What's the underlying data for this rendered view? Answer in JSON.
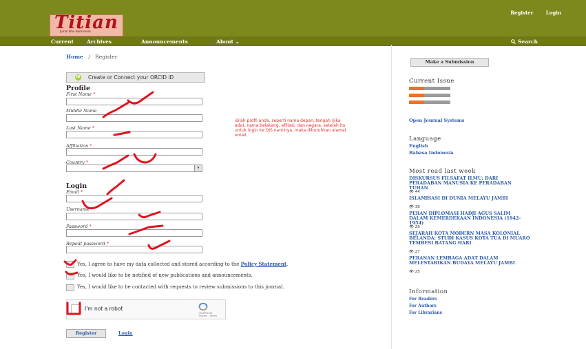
{
  "brand": {
    "logo_text": "Titian",
    "logo_subtitle": "Jurnal Ilmu Humaniora"
  },
  "user_nav": {
    "register": "Register",
    "login": "Login"
  },
  "nav": {
    "items": [
      "Current",
      "Archives",
      "Announcements",
      "About ⌄"
    ],
    "search": "Search"
  },
  "breadcrumb": {
    "home": "Home",
    "sep": "/",
    "current": "Register"
  },
  "form": {
    "orcid_label": "Create or Connect your ORCID iD",
    "profile_title": "Profile",
    "login_title": "Login",
    "fields": {
      "first_name": "First Name",
      "middle_name": "Middle Name",
      "last_name": "Last Name",
      "affiliation": "Affiliation",
      "country": "Country",
      "email": "Email",
      "username": "Username",
      "password": "Password",
      "repeat_password": "Repeat password"
    },
    "required_marker": "*",
    "country_arrow": "▾",
    "consent": {
      "agree_prefix": "Yes, I agree to have my data collected and stored according to the",
      "policy_link": "Policy Statement",
      "agree_suffix": ".",
      "notify": "Yes, I would like to be notified of new publications and announcements.",
      "review": "Yes, I would like to be contacted with requests to review submissions to this journal."
    },
    "captcha": {
      "label": "I'm not a robot",
      "brand": "reCAPTCHA",
      "terms": "Privacy - Terms"
    },
    "register_button": "Register",
    "login_link": "Login"
  },
  "annotation_note": "isilah profil anda, seperti nama depan, tengah (jika ada), nama belakang, afiliasi, dan negara. setelah itu untuk login ke OJS nantinya, maka dibutuhkan alamat email,",
  "sidebar": {
    "submission_button": "Make a Submission",
    "current_issue_title": "Current Issue",
    "ojs_link": "Open Journal Systems",
    "language_title": "Language",
    "languages": [
      "English",
      "Bahasa Indonesia"
    ],
    "most_read_title": "Most read last week",
    "most_read": [
      {
        "title": "DISKURSUS FILSAFAT ILMU: DARI PERADABAN MANUSIA KE PERADABAN TUHAN",
        "views": "44"
      },
      {
        "title": "ISLAMISASI DI DUNIA MELAYU JAMBI",
        "views": "39"
      },
      {
        "title": "PERAN DIPLOMASI HADJI AGUS SALIM DALAM KEMERDEKAAN INDONESIA (1942-1954)",
        "views": "29"
      },
      {
        "title": "SEJARAH KOTA MODERN MASA KOLONIAL BELANDA: STUDI KASUS KOTA TUA DI MUARO TEMBESI BATANG HARI",
        "views": "27"
      },
      {
        "title": "PERANAN LEMBAGA ADAT DALAM MELESTARIKAN BUDAYA MELAYU JAMBI",
        "views": "25"
      }
    ],
    "information_title": "Information",
    "information_links": [
      "For Readers",
      "For Authors",
      "For Librarians"
    ]
  },
  "colors": {
    "header": "#7e891d",
    "link": "#2b5aa8",
    "annotation": "#e0312a"
  }
}
